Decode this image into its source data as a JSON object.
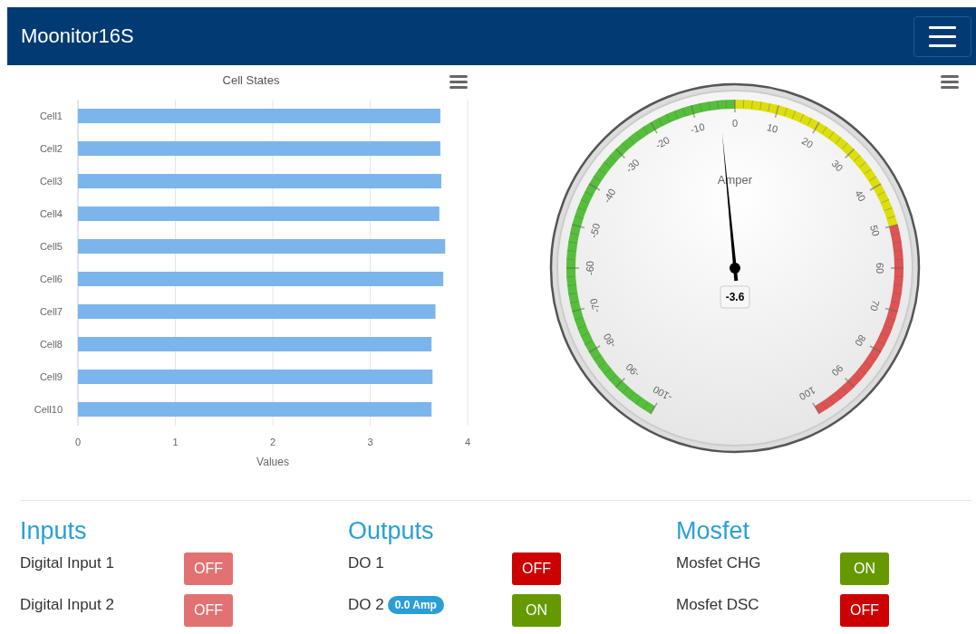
{
  "navbar": {
    "brand": "Moonitor16S"
  },
  "cell_chart": {
    "chart_data": {
      "type": "bar",
      "orientation": "horizontal",
      "title": "Cell States",
      "xlabel": "Values",
      "categories": [
        "Cell1",
        "Cell2",
        "Cell3",
        "Cell4",
        "Cell5",
        "Cell6",
        "Cell7",
        "Cell8",
        "Cell9",
        "Cell10"
      ],
      "series": [
        {
          "color": "#7cb5ec",
          "values": [
            3.72,
            3.72,
            3.73,
            3.71,
            3.77,
            3.75,
            3.67,
            3.63,
            3.64,
            3.63
          ]
        }
      ],
      "xlim": [
        0,
        4
      ],
      "xticks": [
        0,
        1,
        2,
        3,
        4
      ],
      "grid": true
    }
  },
  "current_gauge": {
    "title": "Amper",
    "value": "-3.6",
    "level": 0.482,
    "scale_labels": [
      "-100",
      "-90",
      "-80",
      "-70",
      "-60",
      "-50",
      "-40",
      "-30",
      "-20",
      "-10",
      "0",
      "10",
      "20",
      "30",
      "40",
      "50",
      "60",
      "70",
      "80",
      "90",
      "100"
    ],
    "bands": [
      {
        "color": "#55bf3b"
      },
      {
        "color": "#dddf0d"
      },
      {
        "color": "#df5353"
      }
    ]
  },
  "sections": [
    {
      "title": "Inputs",
      "rows": [
        {
          "label": "Digital Input 1",
          "state": "OFF",
          "on": false,
          "disabled": true
        },
        {
          "label": "Digital Input 2",
          "state": "OFF",
          "on": false,
          "disabled": true
        }
      ]
    },
    {
      "title": "Outputs",
      "rows": [
        {
          "label": "DO 1",
          "state": "OFF",
          "on": false,
          "disabled": false
        },
        {
          "label": "DO 2",
          "badge": "0.0 Amp",
          "state": "ON",
          "on": true,
          "disabled": false
        }
      ]
    },
    {
      "title": "Mosfet",
      "rows": [
        {
          "label": "Mosfet CHG",
          "state": "ON",
          "on": true,
          "disabled": false
        },
        {
          "label": "Mosfet DSC",
          "state": "OFF",
          "on": false,
          "disabled": false
        }
      ]
    }
  ]
}
